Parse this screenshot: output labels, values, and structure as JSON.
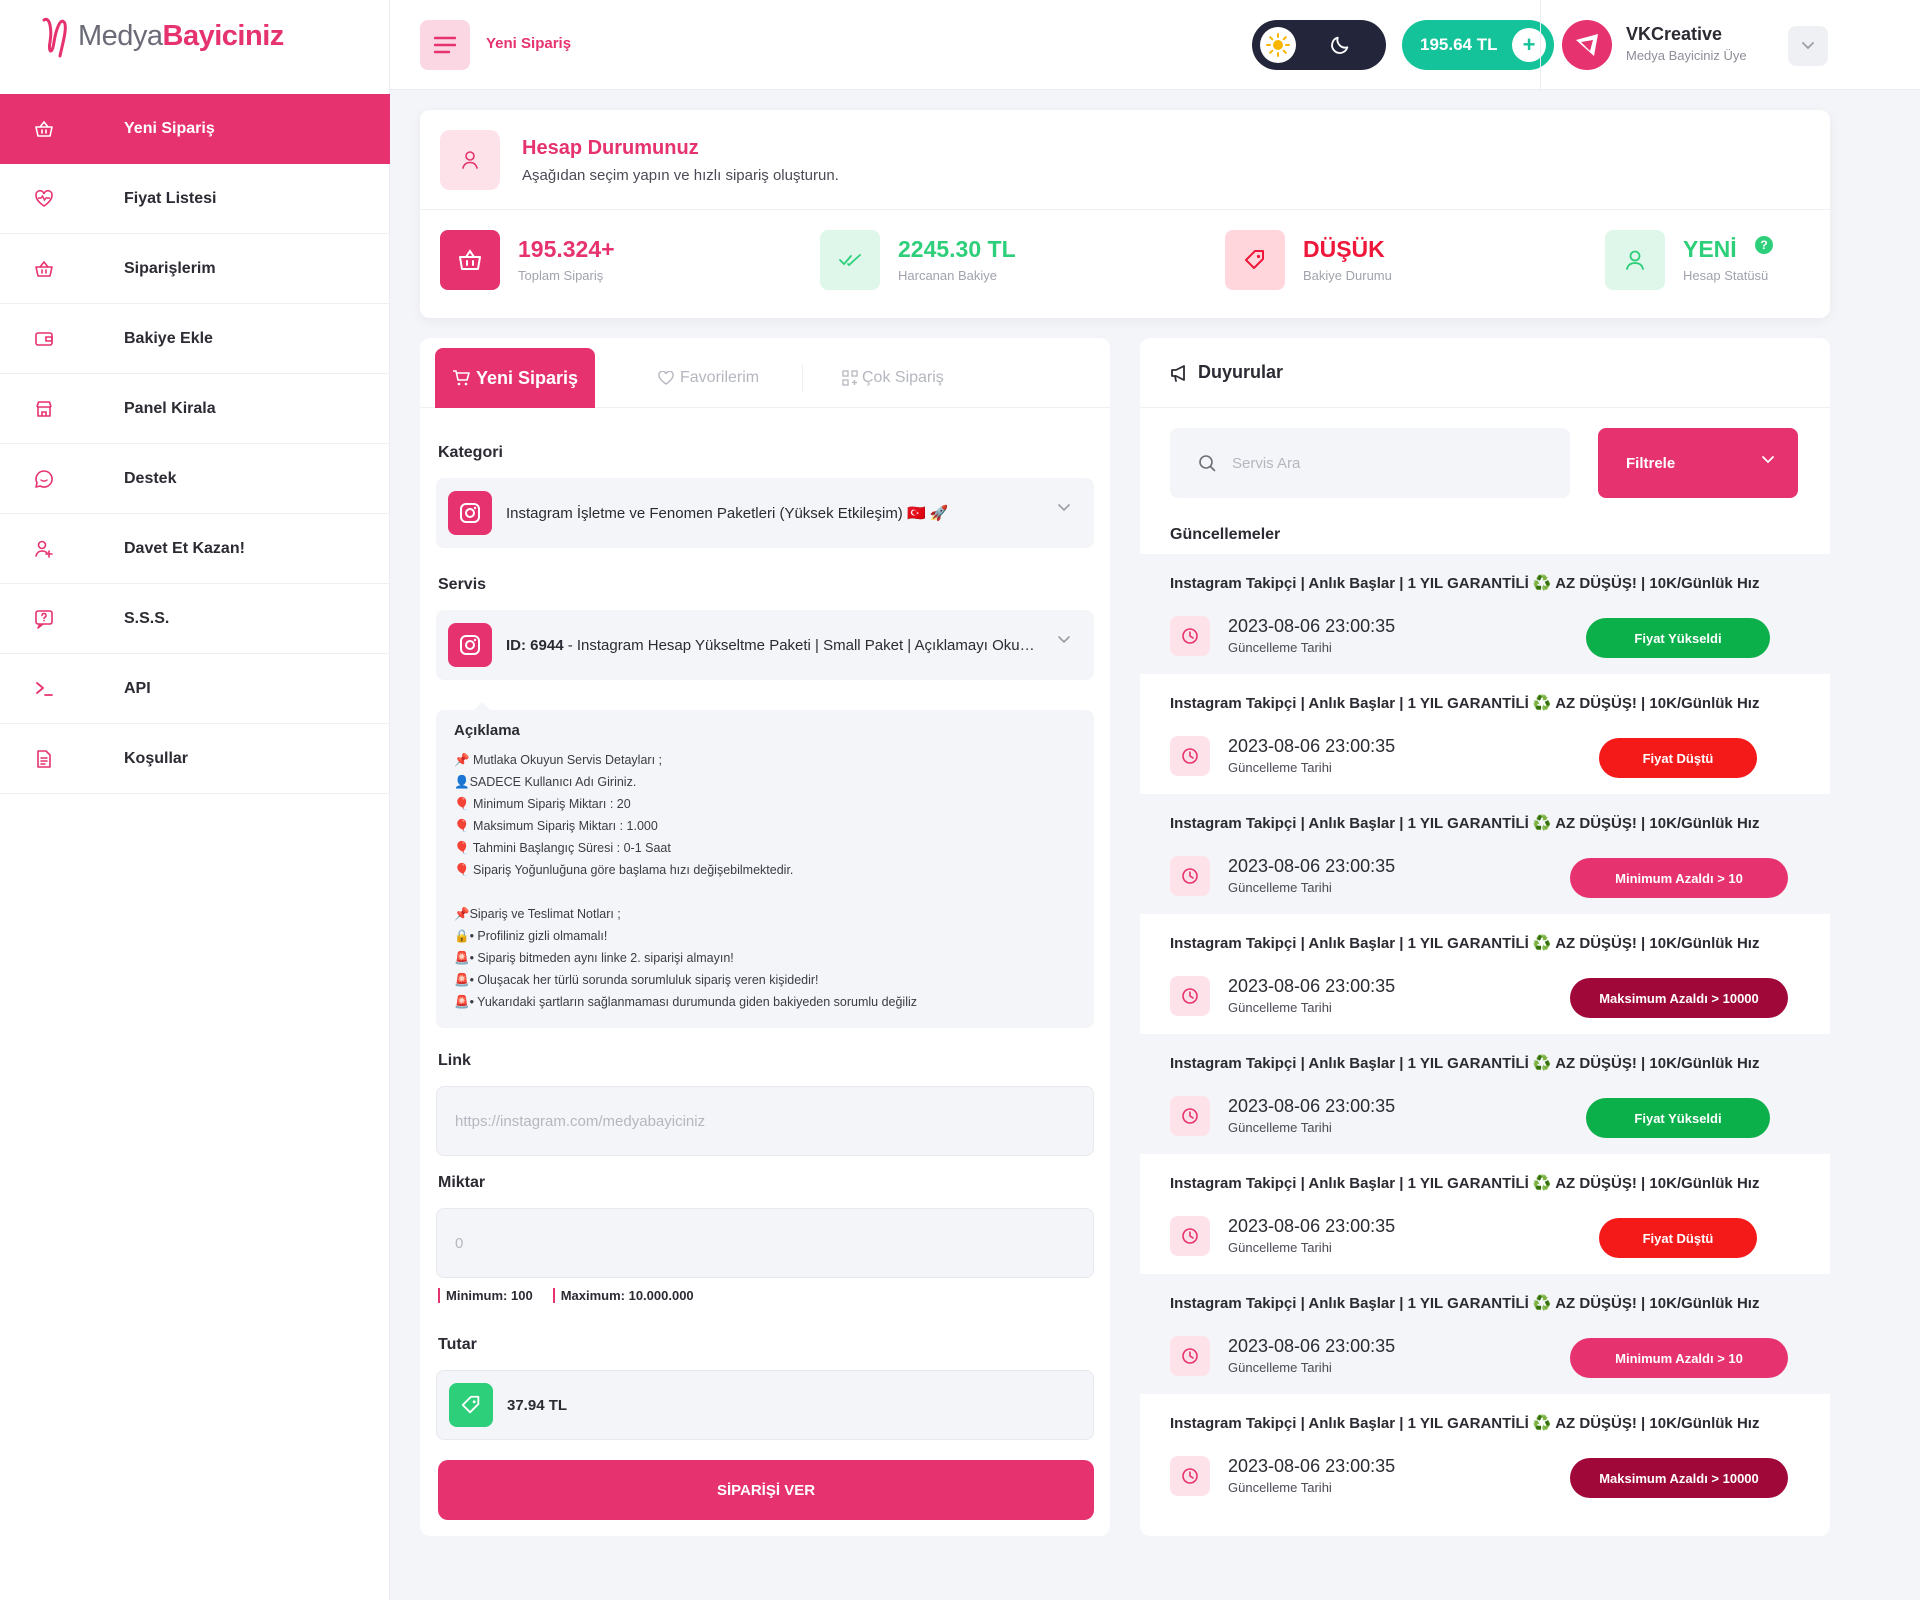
{
  "brand": {
    "name_light": "Medya",
    "name_bold": "Bayiciniz",
    "accent": "#e6326e"
  },
  "sidebar": {
    "items": [
      {
        "label": "Yeni Sipariş",
        "icon": "basket-icon",
        "active": true
      },
      {
        "label": "Fiyat Listesi",
        "icon": "heart-pulse-icon"
      },
      {
        "label": "Siparişlerim",
        "icon": "basket-icon"
      },
      {
        "label": "Bakiye Ekle",
        "icon": "wallet-icon"
      },
      {
        "label": "Panel Kirala",
        "icon": "store-icon"
      },
      {
        "label": "Destek",
        "icon": "chat-icon"
      },
      {
        "label": "Davet Et Kazan!",
        "icon": "user-add-icon"
      },
      {
        "label": "S.S.S.",
        "icon": "question-icon"
      },
      {
        "label": "API",
        "icon": "terminal-icon"
      },
      {
        "label": "Koşullar",
        "icon": "document-icon"
      }
    ]
  },
  "topbar": {
    "breadcrumb": "Yeni Sipariş",
    "balance": "195.64 TL",
    "balance_add": "+",
    "user": {
      "name": "VKCreative",
      "role": "Medya Bayiciniz Üye"
    }
  },
  "account": {
    "title": "Hesap Durumunuz",
    "subtitle": "Aşağıdan seçim yapın ve hızlı sipariş oluşturun.",
    "stats": [
      {
        "value": "195.324+",
        "label": "Toplam Sipariş",
        "color": "#e6326e"
      },
      {
        "value": "2245.30 TL",
        "label": "Harcanan Bakiye",
        "color": "#2ecf7a"
      },
      {
        "value": "DÜŞÜK",
        "label": "Bakiye Durumu",
        "color": "#f0183a"
      },
      {
        "value": "YENİ",
        "label": "Hesap Statüsü",
        "color": "#2ecf7a",
        "help": "?"
      }
    ]
  },
  "order": {
    "tabs": {
      "new": "Yeni Sipariş",
      "favorites": "Favorilerim",
      "bulk": "Çok Sipariş"
    },
    "category_label": "Kategori",
    "category_value": "Instagram İşletme ve Fenomen Paketleri (Yüksek Etkileşim) 🇹🇷 🚀",
    "service_label": "Servis",
    "service_id": "ID: 6944",
    "service_value": " - Instagram Hesap Yükseltme Paketi | Small Paket | Açıklamayı Okuyunuz",
    "description": {
      "title": "Açıklama",
      "lines": [
        "📌 Mutlaka Okuyun Servis Detayları ;",
        "👤SADECE Kullanıcı Adı Giriniz.",
        "🎈 Minimum Sipariş Miktarı : 20",
        "🎈 Maksimum Sipariş Miktarı : 1.000",
        "🎈 Tahmini Başlangıç Süresi : 0-1 Saat",
        "🎈 Sipariş Yoğunluğuna göre başlama hızı değişebilmektedir.",
        "",
        "📌Sipariş ve Teslimat Notları ;",
        "🔒• Profiliniz gizli olmamalı!",
        "🚨• Sipariş bitmeden aynı linke 2. siparişi almayın!",
        "🚨• Oluşacak her türlü sorunda sorumluluk sipariş veren kişidedir!",
        "🚨• Yukarıdaki şartların sağlanmaması durumunda giden bakiyeden sorumlu değiliz"
      ]
    },
    "link_label": "Link",
    "link_placeholder": "https://instagram.com/medyabayiciniz",
    "quantity_label": "Miktar",
    "quantity_placeholder": "0",
    "min_text": "Minimum: 100",
    "max_text": "Maximum: 10.000.000",
    "total_label": "Tutar",
    "total_value": "37.94 TL",
    "submit": "SİPARİŞİ VER"
  },
  "announcements": {
    "title": "Duyurular",
    "search_placeholder": "Servis Ara",
    "filter_label": "Filtrele",
    "updates_label": "Güncellemeler",
    "items": [
      {
        "title": "Instagram Takipçi | Anlık Başlar | 1 YIL GARANTİLİ ♻️ AZ DÜŞÜŞ! | 10K/Günlük Hız",
        "date": "2023-08-06 23:00:35",
        "date_label": "Güncelleme Tarihi",
        "badge": "Fiyat Yükseldi",
        "badge_color": "#0bb04b"
      },
      {
        "title": "Instagram Takipçi | Anlık Başlar | 1 YIL GARANTİLİ ♻️ AZ DÜŞÜŞ! | 10K/Günlük Hız",
        "date": "2023-08-06 23:00:35",
        "date_label": "Güncelleme Tarihi",
        "badge": "Fiyat Düştü",
        "badge_color": "#f51a1a"
      },
      {
        "title": "Instagram Takipçi | Anlık Başlar | 1 YIL GARANTİLİ ♻️ AZ DÜŞÜŞ! | 10K/Günlük Hız",
        "date": "2023-08-06 23:00:35",
        "date_label": "Güncelleme Tarihi",
        "badge": "Minimum Azaldı > 10",
        "badge_color": "#e6326e"
      },
      {
        "title": "Instagram Takipçi | Anlık Başlar | 1 YIL GARANTİLİ ♻️ AZ DÜŞÜŞ! | 10K/Günlük Hız",
        "date": "2023-08-06 23:00:35",
        "date_label": "Güncelleme Tarihi",
        "badge": "Maksimum Azaldı > 10000",
        "badge_color": "#a0083a"
      },
      {
        "title": "Instagram Takipçi | Anlık Başlar | 1 YIL GARANTİLİ ♻️ AZ DÜŞÜŞ! | 10K/Günlük Hız",
        "date": "2023-08-06 23:00:35",
        "date_label": "Güncelleme Tarihi",
        "badge": "Fiyat Yükseldi",
        "badge_color": "#0bb04b"
      },
      {
        "title": "Instagram Takipçi | Anlık Başlar | 1 YIL GARANTİLİ ♻️ AZ DÜŞÜŞ! | 10K/Günlük Hız",
        "date": "2023-08-06 23:00:35",
        "date_label": "Güncelleme Tarihi",
        "badge": "Fiyat Düştü",
        "badge_color": "#f51a1a"
      },
      {
        "title": "Instagram Takipçi | Anlık Başlar | 1 YIL GARANTİLİ ♻️ AZ DÜŞÜŞ! | 10K/Günlük Hız",
        "date": "2023-08-06 23:00:35",
        "date_label": "Güncelleme Tarihi",
        "badge": "Minimum Azaldı > 10",
        "badge_color": "#e6326e"
      },
      {
        "title": "Instagram Takipçi | Anlık Başlar | 1 YIL GARANTİLİ ♻️ AZ DÜŞÜŞ! | 10K/Günlük Hız",
        "date": "2023-08-06 23:00:35",
        "date_label": "Güncelleme Tarihi",
        "badge": "Maksimum Azaldı > 10000",
        "badge_color": "#a0083a"
      }
    ]
  }
}
